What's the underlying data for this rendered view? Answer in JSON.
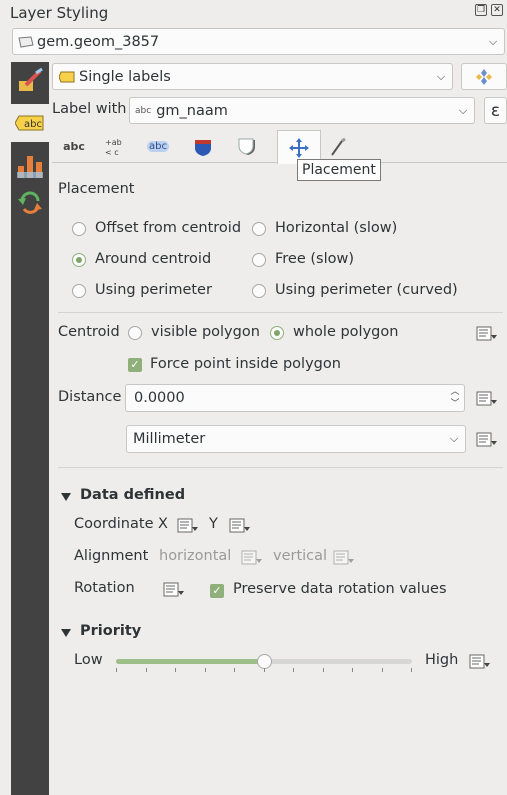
{
  "panel": {
    "title": "Layer Styling"
  },
  "layer_select": {
    "value": "gem.geom_3857"
  },
  "renderer_select": {
    "value": "Single labels"
  },
  "label_with": {
    "label": "Label with",
    "value": "gm_naam",
    "expr_icon": "ε"
  },
  "tabs": {
    "items": [
      {
        "name": "text",
        "glyph": "abc"
      },
      {
        "name": "formatting",
        "glyph": "+ab <c"
      },
      {
        "name": "buffer",
        "glyph": "abc"
      },
      {
        "name": "background",
        "glyph": "shield"
      },
      {
        "name": "shadow",
        "glyph": "shadow"
      },
      {
        "name": "placement",
        "glyph": "move"
      },
      {
        "name": "rendering",
        "glyph": "brush"
      }
    ],
    "tooltip": "Placement"
  },
  "placement": {
    "heading": "Placement",
    "options": [
      {
        "label": "Offset from centroid",
        "selected": false
      },
      {
        "label": "Horizontal (slow)",
        "selected": false
      },
      {
        "label": "Around centroid",
        "selected": true
      },
      {
        "label": "Free (slow)",
        "selected": false
      },
      {
        "label": "Using perimeter",
        "selected": false
      },
      {
        "label": "Using perimeter (curved)",
        "selected": false
      }
    ],
    "centroid_label": "Centroid",
    "centroid_visible": "visible polygon",
    "centroid_whole": "whole polygon",
    "force_inside": "Force point inside polygon",
    "distance_label": "Distance",
    "distance_value": "0.0000",
    "unit": "Millimeter"
  },
  "data_defined": {
    "heading": "Data defined",
    "coordinate": "Coordinate",
    "x": "X",
    "y": "Y",
    "alignment": "Alignment",
    "horizontal": "horizontal",
    "vertical": "vertical",
    "rotation": "Rotation",
    "preserve": "Preserve data rotation values"
  },
  "priority": {
    "heading": "Priority",
    "low": "Low",
    "high": "High",
    "value_fraction": 0.5
  },
  "colors": {
    "accent": "#8fb07a",
    "sidebar": "#424242"
  }
}
